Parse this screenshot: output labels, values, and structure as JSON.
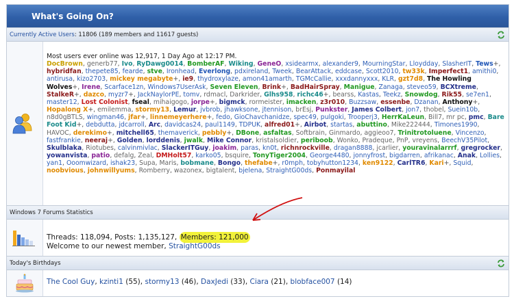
{
  "header": {
    "title": "What's Going On?"
  },
  "active_users": {
    "label": "Currently Active Users",
    "summary": ": 11806 (189 members and 11617 guests)",
    "most_online": "Most users ever online was 12,917, 1 Day Ago at 12:17 PM.",
    "users": [
      {
        "n": "DocBrown",
        "c": "gold",
        "s": ","
      },
      {
        "n": "generb77",
        "c": "grey",
        "s": ","
      },
      {
        "n": "Ivo",
        "c": "teal",
        "s": ","
      },
      {
        "n": "RyDawg0014",
        "c": "teal",
        "s": ","
      },
      {
        "n": "BomberAF",
        "c": "green",
        "s": ","
      },
      {
        "n": "Wiking",
        "c": "teal",
        "s": ","
      },
      {
        "n": "GeneO",
        "c": "purple",
        "s": ","
      },
      {
        "n": "xsidearmx",
        "c": "blue",
        "s": ","
      },
      {
        "n": "alexander9",
        "c": "blue",
        "s": ","
      },
      {
        "n": "MourningStar",
        "c": "blue",
        "s": ","
      },
      {
        "n": "Lloydday",
        "c": "blue",
        "s": ","
      },
      {
        "n": "SlasherIT",
        "c": "blue",
        "s": ","
      },
      {
        "n": "Tews",
        "c": "blueb",
        "s": "+,"
      },
      {
        "n": "hybridfan",
        "c": "maroon",
        "s": ","
      },
      {
        "n": "thepete85",
        "c": "blue",
        "s": ","
      },
      {
        "n": "fearde",
        "c": "blue",
        "s": ","
      },
      {
        "n": "stve",
        "c": "green",
        "s": ","
      },
      {
        "n": "Ironhead",
        "c": "blue",
        "s": ","
      },
      {
        "n": "Everlong",
        "c": "blueb",
        "s": ","
      },
      {
        "n": "pdxireland",
        "c": "blue",
        "s": ","
      },
      {
        "n": "Tweek",
        "c": "blue",
        "s": ","
      },
      {
        "n": "BearAttack",
        "c": "blue",
        "s": ","
      },
      {
        "n": "eddcase",
        "c": "blue",
        "s": ","
      },
      {
        "n": "Scott2010",
        "c": "blue",
        "s": ","
      },
      {
        "n": "tw33k",
        "c": "orange",
        "s": ","
      },
      {
        "n": "Imperfect1",
        "c": "maroon",
        "s": ","
      },
      {
        "n": "amithi0",
        "c": "blue",
        "s": ","
      },
      {
        "n": "antirusa",
        "c": "blue",
        "s": ","
      },
      {
        "n": "kizo2703",
        "c": "blue",
        "s": ","
      },
      {
        "n": "mickey megabyte",
        "c": "orange",
        "s": "+,"
      },
      {
        "n": "ie9",
        "c": "maroon",
        "s": ","
      },
      {
        "n": "thydroxylaze",
        "c": "blue",
        "s": ","
      },
      {
        "n": "amon41amarth",
        "c": "blue",
        "s": ","
      },
      {
        "n": "TGMcCallie",
        "c": "blue",
        "s": ","
      },
      {
        "n": "xxxdannyxxx",
        "c": "blue",
        "s": ","
      },
      {
        "n": "KLR",
        "c": "blue",
        "s": ","
      },
      {
        "n": "gzt7d8",
        "c": "orange",
        "s": ","
      },
      {
        "n": "The Howling Wolves",
        "c": "black",
        "s": "+,"
      },
      {
        "n": "Irene",
        "c": "purple",
        "s": ","
      },
      {
        "n": "Scarface1zn",
        "c": "blue",
        "s": ","
      },
      {
        "n": "Windows7UserAsk",
        "c": "blue",
        "s": ","
      },
      {
        "n": "Seven Eleven",
        "c": "green",
        "s": ","
      },
      {
        "n": "Brink",
        "c": "maroon",
        "s": "+,"
      },
      {
        "n": "BadHairSpray",
        "c": "maroon",
        "s": ","
      },
      {
        "n": "Manigue",
        "c": "green",
        "s": ","
      },
      {
        "n": "Zanaga",
        "c": "blue",
        "s": ","
      },
      {
        "n": "steveo59",
        "c": "blue",
        "s": ","
      },
      {
        "n": "BCXtreme",
        "c": "navy",
        "s": ","
      },
      {
        "n": "StalkeR",
        "c": "maroon",
        "s": "+,"
      },
      {
        "n": "dazco",
        "c": "orange",
        "s": ","
      },
      {
        "n": "myzr7",
        "c": "blue",
        "s": "+,"
      },
      {
        "n": "JackNaylorPE",
        "c": "blue",
        "s": ","
      },
      {
        "n": "tomv",
        "c": "blue",
        "s": ","
      },
      {
        "n": "rdmacl",
        "c": "grey",
        "s": ","
      },
      {
        "n": "Darkrider",
        "c": "grey",
        "s": ","
      },
      {
        "n": "Glhs958",
        "c": "teal",
        "s": ","
      },
      {
        "n": "richc46",
        "c": "teal",
        "s": "+,"
      },
      {
        "n": "bearss",
        "c": "grey",
        "s": ","
      },
      {
        "n": "Kastas",
        "c": "blue",
        "s": ","
      },
      {
        "n": "Teekz",
        "c": "blue",
        "s": ","
      },
      {
        "n": "Snowdog",
        "c": "green",
        "s": ","
      },
      {
        "n": "Rik55",
        "c": "maroon",
        "s": ","
      },
      {
        "n": "se7en1",
        "c": "blue",
        "s": ","
      },
      {
        "n": "master12",
        "c": "blue",
        "s": ","
      },
      {
        "n": "Lost Colonist",
        "c": "red",
        "s": ","
      },
      {
        "n": "fseal",
        "c": "black",
        "s": ","
      },
      {
        "n": "mihaigogo",
        "c": "grey",
        "s": ","
      },
      {
        "n": "jorpe",
        "c": "purple",
        "s": "+,"
      },
      {
        "n": "bigmck",
        "c": "navy",
        "s": ","
      },
      {
        "n": "rormeister",
        "c": "grey",
        "s": ","
      },
      {
        "n": "imacken",
        "c": "green",
        "s": ","
      },
      {
        "n": "z3r010",
        "c": "maroon",
        "s": ","
      },
      {
        "n": "Buzzsaw",
        "c": "blue",
        "s": ","
      },
      {
        "n": "essenbe",
        "c": "maroon",
        "s": ","
      },
      {
        "n": "Dzanan",
        "c": "blue",
        "s": ","
      },
      {
        "n": "Anthony",
        "c": "black",
        "s": "+,"
      },
      {
        "n": "Hopalong X",
        "c": "orange",
        "s": "+,"
      },
      {
        "n": "emilemma",
        "c": "grey",
        "s": ","
      },
      {
        "n": "stormy13",
        "c": "orange",
        "s": ","
      },
      {
        "n": "Lemur",
        "c": "navy",
        "s": ","
      },
      {
        "n": "jvbrob",
        "c": "blue",
        "s": ","
      },
      {
        "n": "jhawksone",
        "c": "blue",
        "s": ","
      },
      {
        "n": "jtennison",
        "c": "blue",
        "s": ","
      },
      {
        "n": "brEsj",
        "c": "grey",
        "s": ","
      },
      {
        "n": "Punkster",
        "c": "purple",
        "s": ","
      },
      {
        "n": "James Colbert",
        "c": "navy",
        "s": ","
      },
      {
        "n": "jon7",
        "c": "blue",
        "s": ","
      },
      {
        "n": "thobel",
        "c": "grey",
        "s": ","
      },
      {
        "n": "Suein10b",
        "c": "blue",
        "s": ","
      },
      {
        "n": "n8d0gBTLS",
        "c": "grey",
        "s": ","
      },
      {
        "n": "wingman46",
        "c": "blue",
        "s": ","
      },
      {
        "n": "jfar",
        "c": "orange",
        "s": "+,"
      },
      {
        "n": "linnemeyerhere",
        "c": "orange",
        "s": "+,"
      },
      {
        "n": "fedo",
        "c": "blue",
        "s": ","
      },
      {
        "n": "GioChavchanidze",
        "c": "blue",
        "s": ","
      },
      {
        "n": "spec49",
        "c": "blue",
        "s": ","
      },
      {
        "n": "pulgoki",
        "c": "blue",
        "s": ","
      },
      {
        "n": "Trooperj3",
        "c": "blue",
        "s": ","
      },
      {
        "n": "HerrKaLeun",
        "c": "green",
        "s": ","
      },
      {
        "n": "Bill7",
        "c": "grey",
        "s": ","
      },
      {
        "n": "mr pc",
        "c": "grey",
        "s": ","
      },
      {
        "n": "pmc",
        "c": "navy",
        "s": ","
      },
      {
        "n": "Bare Foot Kid",
        "c": "teal",
        "s": "+,"
      },
      {
        "n": "debdutta",
        "c": "blue",
        "s": ","
      },
      {
        "n": "jdcarroll",
        "c": "blue",
        "s": ","
      },
      {
        "n": "Arc",
        "c": "navy",
        "s": ","
      },
      {
        "n": "davidcas24",
        "c": "blue",
        "s": ","
      },
      {
        "n": "paul1149",
        "c": "blue",
        "s": ","
      },
      {
        "n": "TDPUK",
        "c": "blue",
        "s": ","
      },
      {
        "n": "alfred01",
        "c": "maroon",
        "s": "+,"
      },
      {
        "n": "Airbot",
        "c": "navy",
        "s": ","
      },
      {
        "n": "startas",
        "c": "blue",
        "s": ","
      },
      {
        "n": "abuttino",
        "c": "green",
        "s": ","
      },
      {
        "n": "Mike222444",
        "c": "grey",
        "s": ","
      },
      {
        "n": "Timones1990",
        "c": "blue",
        "s": ","
      },
      {
        "n": "HAVOC",
        "c": "grey",
        "s": ","
      },
      {
        "n": "derekimo",
        "c": "orange",
        "s": "+,"
      },
      {
        "n": "mitchell65",
        "c": "navy",
        "s": ","
      },
      {
        "n": "themaverick",
        "c": "blue",
        "s": ","
      },
      {
        "n": "pebbly",
        "c": "orange",
        "s": "+,"
      },
      {
        "n": "DBone",
        "c": "green",
        "s": ","
      },
      {
        "n": "asfaltas",
        "c": "green",
        "s": ","
      },
      {
        "n": "Softbrain",
        "c": "grey",
        "s": ","
      },
      {
        "n": "Ginmardo",
        "c": "grey",
        "s": ","
      },
      {
        "n": "aggieoo7",
        "c": "grey",
        "s": ","
      },
      {
        "n": "Trinitrotoluene",
        "c": "green",
        "s": ","
      },
      {
        "n": "Vincenzo",
        "c": "blue",
        "s": ","
      },
      {
        "n": "fastfrankie",
        "c": "blue",
        "s": ","
      },
      {
        "n": "neeraj",
        "c": "maroon",
        "s": "+,"
      },
      {
        "n": "Golden",
        "c": "navy",
        "s": ","
      },
      {
        "n": "lorddenis",
        "c": "navy",
        "s": ","
      },
      {
        "n": "jwalk",
        "c": "green",
        "s": ","
      },
      {
        "n": "Mike Connor",
        "c": "navy",
        "s": ","
      },
      {
        "n": "kristalsoldier",
        "c": "grey",
        "s": ","
      },
      {
        "n": "periboob",
        "c": "green",
        "s": ","
      },
      {
        "n": "Wonko",
        "c": "grey",
        "s": ","
      },
      {
        "n": "Pradeque",
        "c": "grey",
        "s": ","
      },
      {
        "n": "PnP",
        "c": "grey",
        "s": ","
      },
      {
        "n": "vreyens",
        "c": "grey",
        "s": ","
      },
      {
        "n": "BeechV35Pilot",
        "c": "blue",
        "s": ","
      },
      {
        "n": "Skulblaka",
        "c": "navy",
        "s": ","
      },
      {
        "n": "Riotubes",
        "c": "grey",
        "s": ","
      },
      {
        "n": "calvinmivlac",
        "c": "blue",
        "s": ","
      },
      {
        "n": "SlackerITGuy",
        "c": "navy",
        "s": ","
      },
      {
        "n": "joakim",
        "c": "purple",
        "s": ","
      },
      {
        "n": "paras",
        "c": "blue",
        "s": ","
      },
      {
        "n": "kn0t",
        "c": "blue",
        "s": ","
      },
      {
        "n": "richnrockville",
        "c": "maroon",
        "s": ","
      },
      {
        "n": "dragan8888",
        "c": "blue",
        "s": ","
      },
      {
        "n": "jcarlier",
        "c": "grey",
        "s": ","
      },
      {
        "n": "youravinalarrrf",
        "c": "green",
        "s": ","
      },
      {
        "n": "gregrocker",
        "c": "navy",
        "s": ","
      },
      {
        "n": "yowanvista",
        "c": "navy",
        "s": ","
      },
      {
        "n": "patio",
        "c": "purple",
        "s": ","
      },
      {
        "n": "defalg",
        "c": "grey",
        "s": ","
      },
      {
        "n": "Zeal",
        "c": "grey",
        "s": ","
      },
      {
        "n": "DMHolt57",
        "c": "red",
        "s": ","
      },
      {
        "n": "karko05",
        "c": "blue",
        "s": ","
      },
      {
        "n": "bsquire",
        "c": "grey",
        "s": ","
      },
      {
        "n": "TonyTiger2004",
        "c": "green",
        "s": ","
      },
      {
        "n": "George4480",
        "c": "blue",
        "s": ","
      },
      {
        "n": "jonnyfrost",
        "c": "blue",
        "s": ","
      },
      {
        "n": "bigdarren",
        "c": "blue",
        "s": ","
      },
      {
        "n": "afrikanac",
        "c": "blue",
        "s": ","
      },
      {
        "n": "Anak",
        "c": "navy",
        "s": ","
      },
      {
        "n": "Lollies",
        "c": "blue",
        "s": ","
      },
      {
        "n": "yan1",
        "c": "blue",
        "s": ","
      },
      {
        "n": "Ooomwizard",
        "c": "blue",
        "s": ","
      },
      {
        "n": "ishak23",
        "c": "blue",
        "s": ","
      },
      {
        "n": "Supa",
        "c": "grey",
        "s": ","
      },
      {
        "n": "Maris",
        "c": "grey",
        "s": ","
      },
      {
        "n": "bobmane",
        "c": "teal",
        "s": ","
      },
      {
        "n": "Bongo",
        "c": "navy",
        "s": ","
      },
      {
        "n": "thefabe",
        "c": "orange",
        "s": "+,"
      },
      {
        "n": "r0mph",
        "c": "blue",
        "s": ","
      },
      {
        "n": "tobyhutton1234",
        "c": "blue",
        "s": ","
      },
      {
        "n": "ken9122",
        "c": "orange",
        "s": ","
      },
      {
        "n": "CarlTR6",
        "c": "navy",
        "s": ","
      },
      {
        "n": "Kari",
        "c": "orange",
        "s": "+,"
      },
      {
        "n": "Squid",
        "c": "blue",
        "s": ","
      },
      {
        "n": "noobvious",
        "c": "orange",
        "s": ","
      },
      {
        "n": "johnwillyums",
        "c": "orange",
        "s": ","
      },
      {
        "n": "Romberry",
        "c": "grey",
        "s": ","
      },
      {
        "n": "wazonex",
        "c": "grey",
        "s": ","
      },
      {
        "n": "bigtalent",
        "c": "grey",
        "s": ","
      },
      {
        "n": "bjelena",
        "c": "blue",
        "s": ","
      },
      {
        "n": "StraightG00ds",
        "c": "blue",
        "s": ","
      },
      {
        "n": "Ponmayilal",
        "c": "maroon",
        "s": ""
      }
    ]
  },
  "stats": {
    "label": "Windows 7 Forums Statistics",
    "threads_posts": "Threads: 118,094, Posts: 1,135,127,",
    "members": "Members: 121,000",
    "welcome": "Welcome to our newest member,",
    "newest_member": "StraightG00ds"
  },
  "birthdays": {
    "label": "Today's Birthdays",
    "people": [
      {
        "name": "The Cool Guy",
        "age": ""
      },
      {
        "name": "kzinti1",
        "age": "(55)"
      },
      {
        "name": "stormy13",
        "age": "(46)"
      },
      {
        "name": "DaxJedi",
        "age": "(33)"
      },
      {
        "name": "Ciara",
        "age": "(21)"
      },
      {
        "name": "blobface007",
        "age": "(14)"
      }
    ]
  },
  "colors": {
    "header_blue": "#2f5fa8",
    "highlight_yellow": "#f2f23a",
    "annotation_red": "#d01010"
  },
  "icons": [
    "refresh-icon",
    "users-online-icon",
    "stats-chart-icon",
    "birthday-cake-icon",
    "arrow-annotation"
  ]
}
